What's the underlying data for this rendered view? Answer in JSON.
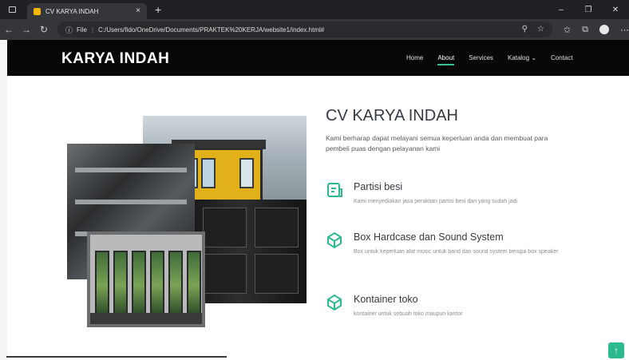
{
  "browser": {
    "tab_title": "CV KARYA INDAH",
    "tab_close": "×",
    "new_tab": "+",
    "win_minimize": "–",
    "win_restore": "❐",
    "win_close": "✕",
    "back": "←",
    "forward": "→",
    "reload": "↻",
    "address_scheme": "File",
    "address_url": "C:/Users/fido/OneDrive/Documents/PRAKTEK%20KERJA/website1/index.html#",
    "icon_names": [
      "window-menu-icon",
      "favicon-icon",
      "info-icon",
      "zoom-icon",
      "star-icon",
      "favorites-icon",
      "collections-icon",
      "profile-icon",
      "more-icon"
    ]
  },
  "site": {
    "logo": "KARYA INDAH",
    "nav": [
      "Home",
      "About",
      "Services",
      "Katalog",
      "Contact"
    ],
    "nav_active": "About",
    "dropdown_caret": "⌄"
  },
  "about": {
    "title": "CV KARYA INDAH",
    "intro": "Kami berharap dapat melayani semua keperluan anda dan membuat para pembeli puas dengan pelayanan kami",
    "services": [
      {
        "icon": "document-icon",
        "title": "Partisi besi",
        "desc": "Kami menyediakan jasa perakitan partisi besi dan yang sudah jadi"
      },
      {
        "icon": "cube-icon",
        "title": "Box Hardcase dan Sound System",
        "desc": "Box untuk keperluan alat music untuk band dan sound system berupa box speaker"
      },
      {
        "icon": "cube-icon",
        "title": "Kontainer toko",
        "desc": "kontainer untuk sebuah toko maupun kantor"
      }
    ]
  },
  "back_to_top": "↑",
  "colors": {
    "accent": "#2db88d",
    "header_bg": "#070708",
    "browser_bg": "#202124"
  }
}
